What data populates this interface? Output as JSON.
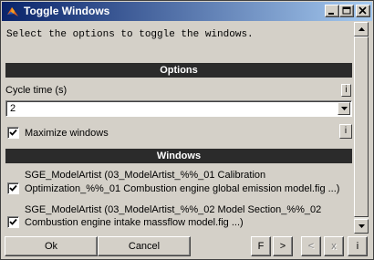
{
  "window": {
    "title": "Toggle Windows",
    "controls": {
      "minimize": "_",
      "maximize": "□",
      "close": "✕"
    },
    "app_icon": "matlab-icon"
  },
  "prompt": "Select the options to toggle the windows.",
  "options_section": {
    "header": "Options",
    "cycle_time_label": "Cycle time (s)",
    "cycle_time_value": "2",
    "info_label": "i",
    "maximize_label": "Maximize windows",
    "maximize_checked": true
  },
  "windows_section": {
    "header": "Windows",
    "items": [
      {
        "line1": "SGE_ModelArtist (03_ModelArtist_%%_01 Calibration",
        "line2": "Optimization_%%_01 Combustion engine global emission model.fig ...)",
        "checked": true
      },
      {
        "line1": "SGE_ModelArtist (03_ModelArtist_%%_02 Model Section_%%_02",
        "line2": "Combustion engine intake massflow model.fig ...)",
        "checked": true
      }
    ]
  },
  "footer": {
    "ok": "Ok",
    "cancel": "Cancel",
    "f": "F",
    "next": ">",
    "prev": "<",
    "x": "x",
    "info": "i"
  }
}
